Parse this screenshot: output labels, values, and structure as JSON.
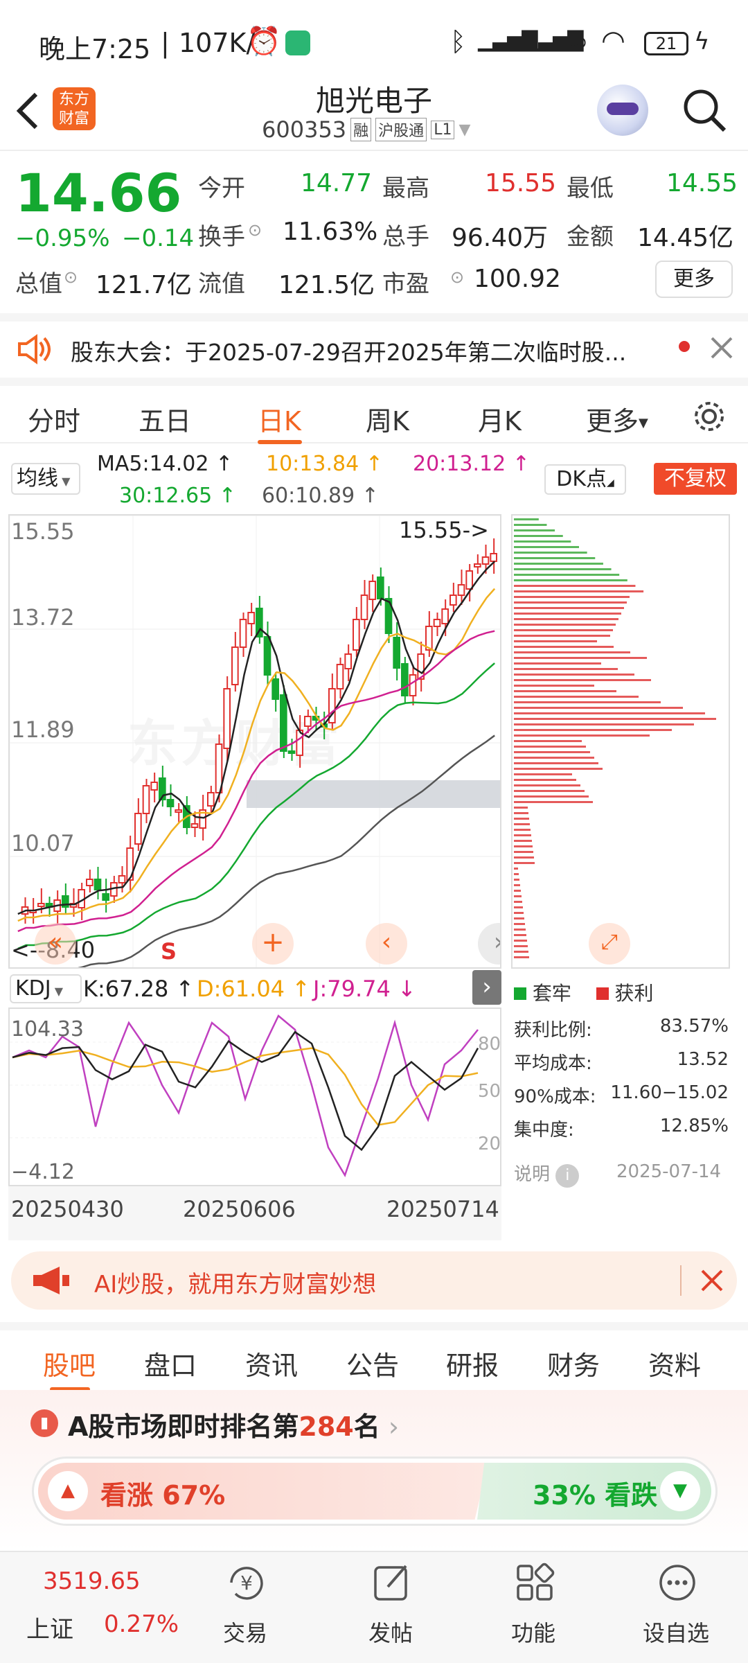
{
  "status_bar": {
    "time": "晚上7:25",
    "speed": "107K/s",
    "battery": "21"
  },
  "header": {
    "title": "旭光电子",
    "code": "600353",
    "tag1": "融",
    "tag2": "沪股通",
    "tag3": "L1",
    "logo_line1": "东方",
    "logo_line2": "财富"
  },
  "quote": {
    "price": "14.66",
    "pct": "−0.95%",
    "chg": "−0.14",
    "open_label": "今开",
    "open": "14.77",
    "high_label": "最高",
    "high": "15.55",
    "low_label": "最低",
    "low": "14.55",
    "turnover_label": "换手",
    "turnover": "11.63%",
    "volume_label": "总手",
    "volume": "96.40万",
    "amount_label": "金额",
    "amount": "14.45亿",
    "mcap_label": "总值",
    "mcap": "121.7亿",
    "float_label": "流值",
    "float": "121.5亿",
    "pe_label": "市盈",
    "pe": "100.92",
    "more": "更多"
  },
  "notice": {
    "text": "股东大会：于2025-07-29召开2025年第二次临时股..."
  },
  "tabs": [
    "分时",
    "五日",
    "日K",
    "周K",
    "月K",
    "更多"
  ],
  "ma_bar": {
    "selector": "均线",
    "ma5": "MA5:14.02 ↑",
    "ma10": "10:13.84 ↑",
    "ma20": "20:13.12 ↑",
    "ma30": "30:12.65 ↑",
    "ma60": "60:10.89 ↑",
    "dk": "DK点",
    "adjust": "不复权"
  },
  "kline": {
    "y_labels": [
      "15.55",
      "13.72",
      "11.89",
      "10.07"
    ],
    "max_tag": "15.55->",
    "min_tag": "<--8.40",
    "sell_tag": "S",
    "watermark": "东方财富"
  },
  "kdj": {
    "selector": "KDJ",
    "k": "K:67.28 ↑",
    "d": "D:61.04 ↑",
    "j": "J:79.74 ↓",
    "top": "104.33",
    "bottom": "−4.12",
    "l80": "80",
    "l50": "50",
    "l20": "20"
  },
  "dates": [
    "20250430",
    "20250606",
    "20250714"
  ],
  "chip": {
    "legend1": "套牢",
    "legend2": "获利",
    "rows": [
      [
        "获利比例:",
        "83.57%"
      ],
      [
        "平均成本:",
        "13.52"
      ],
      [
        "90%成本:",
        "11.60−15.02"
      ],
      [
        "集中度:",
        "12.85%"
      ]
    ],
    "note_label": "说明",
    "note_date": "2025-07-14"
  },
  "ad": {
    "text": "AI炒股，就用东方财富妙想"
  },
  "bottom_tabs": [
    "股吧",
    "盘口",
    "资讯",
    "公告",
    "研报",
    "财务",
    "资料"
  ],
  "rank": {
    "prefix": "A股市场即时排名第",
    "num": "284",
    "suffix": "名"
  },
  "vote": {
    "up": "看涨 67%",
    "down": "33% 看跌"
  },
  "nav": {
    "index_value": "3519.65",
    "index_name": "上证",
    "index_pct": "0.27%",
    "items": [
      "交易",
      "发帖",
      "功能",
      "设自选"
    ]
  },
  "colors": {
    "red": "#e0302e",
    "green": "#14a830",
    "accent": "#f26522"
  }
}
